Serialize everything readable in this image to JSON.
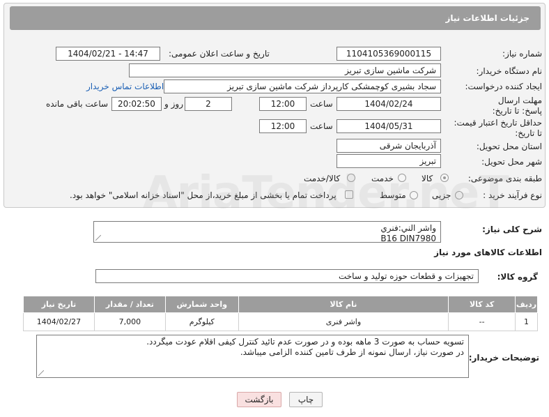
{
  "header": {
    "title": "جزئیات اطلاعات نیاز"
  },
  "form": {
    "need_number_label": "شماره نیاز:",
    "need_number": "1104105369000115",
    "announce_label": "تاریخ و ساعت اعلان عمومی:",
    "announce_value": "1404/02/21 - 14:47",
    "buyer_org_label": "نام دستگاه خریدار:",
    "buyer_org": "شرکت ماشین سازی تبریز",
    "creator_label": "ایجاد کننده درخواست:",
    "creator": "سجاد بشیری کوچمشکی کارپرداز شرکت ماشین سازی تبریز",
    "contact_link": "اطلاعات تماس خریدار",
    "deadline_label": "مهلت ارسال پاسخ: تا تاریخ:",
    "deadline_date": "1404/02/24",
    "time_label": "ساعت",
    "deadline_time": "12:00",
    "days_value": "2",
    "days_label": "روز و",
    "remaining_time": "20:02:50",
    "remaining_label": "ساعت باقی مانده",
    "min_price_label": "حداقل تاریخ اعتبار قیمت: تا تاریخ:",
    "min_price_date": "1404/05/31",
    "min_price_time": "12:00",
    "province_label": "استان محل تحویل:",
    "province": "آذربایجان شرقی",
    "city_label": "شهر محل تحویل:",
    "city": "تبریز",
    "category_label": "طبقه بندی موضوعی:",
    "category_options": [
      "کالا",
      "خدمت",
      "کالا/خدمت"
    ],
    "category_selected": "کالا",
    "process_label": "نوع فرآیند خرید :",
    "process_options": [
      "جزیی",
      "متوسط"
    ],
    "payment_note": "پرداخت تمام یا بخشی از مبلغ خرید،از محل \"اسناد خزانه اسلامی\" خواهد بود."
  },
  "description": {
    "label": "شرح کلی نیاز:",
    "line1": "واشر الني:فنري",
    "line2": "B16    DIN7980"
  },
  "goods_section": {
    "title": "اطلاعات کالاهای مورد نیاز"
  },
  "goods_group": {
    "label": "گروه کالا:",
    "value": "تجهیزات و قطعات حوزه تولید و ساخت"
  },
  "table": {
    "headers": [
      "ردیف",
      "کد کالا",
      "نام کالا",
      "واحد شمارش",
      "تعداد / مقدار",
      "تاریخ نیاز"
    ],
    "rows": [
      [
        "1",
        "--",
        "واشر فنری",
        "کیلوگرم",
        "7,000",
        "1404/02/27"
      ]
    ]
  },
  "buyer_notes": {
    "label": "توضیحات خریدار:",
    "line1": "تسویه حساب به صورت 3 ماهه بوده و در صورت عدم تائید کنترل کیفی اقلام عودت میگردد.",
    "line2": "در صورت نیاز، ارسال نمونه از طرف تامین کننده الزامی میباشد."
  },
  "buttons": {
    "print": "چاپ",
    "back": "بازگشت"
  },
  "watermark": "AriaTender.neT",
  "colors": {
    "header_bg": "#9d9d9d",
    "link": "#1a5fb4",
    "back_button_bg": "#f9e0e0"
  }
}
